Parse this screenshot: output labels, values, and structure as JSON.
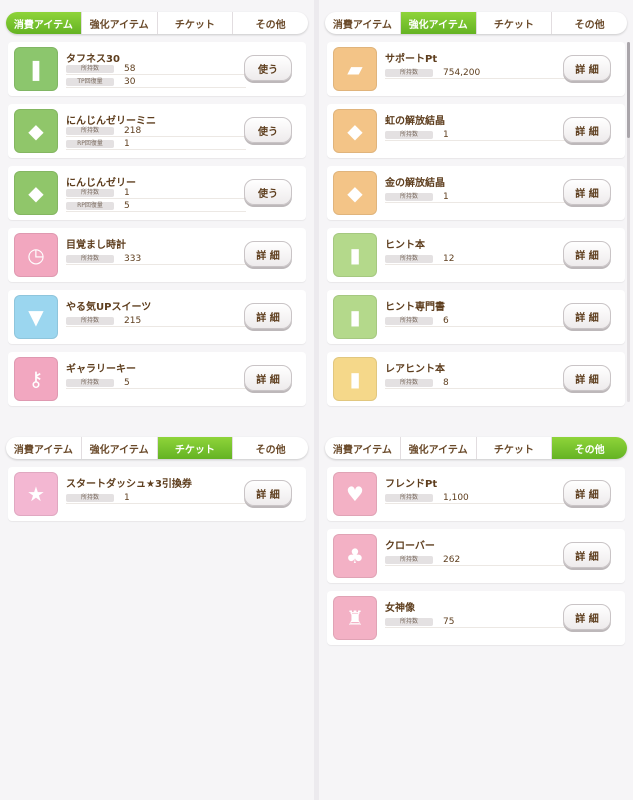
{
  "panels": [
    {
      "tabs": [
        {
          "label": "消費アイテム",
          "active": true
        },
        {
          "label": "強化アイテム",
          "active": false
        },
        {
          "label": "チケット",
          "active": false
        },
        {
          "label": "その他",
          "active": false
        }
      ],
      "items": [
        {
          "name": "タフネス30",
          "icon": "juice-bottle-icon",
          "icon_color": "#8cc66d",
          "stats": [
            {
              "label": "所持数",
              "value": "58"
            },
            {
              "label": "TP回復量",
              "value": "30"
            }
          ],
          "button": "使う"
        },
        {
          "name": "にんじんゼリーミニ",
          "icon": "carrot-jelly-mini-icon",
          "icon_color": "#90c66a",
          "stats": [
            {
              "label": "所持数",
              "value": "218"
            },
            {
              "label": "RP回復量",
              "value": "1"
            }
          ],
          "button": "使う"
        },
        {
          "name": "にんじんゼリー",
          "icon": "carrot-jelly-icon",
          "icon_color": "#90c66a",
          "stats": [
            {
              "label": "所持数",
              "value": "1"
            },
            {
              "label": "RP回復量",
              "value": "5"
            }
          ],
          "button": "使う"
        },
        {
          "name": "目覚まし時計",
          "icon": "alarm-clock-icon",
          "icon_color": "#f2a7bf",
          "stats": [
            {
              "label": "所持数",
              "value": "333"
            }
          ],
          "button": "詳 細"
        },
        {
          "name": "やる気UPスイーツ",
          "icon": "parfait-icon",
          "icon_color": "#9bd6ef",
          "stats": [
            {
              "label": "所持数",
              "value": "215"
            }
          ],
          "button": "詳 細"
        },
        {
          "name": "ギャラリーキー",
          "icon": "key-icon",
          "icon_color": "#f2a7c0",
          "stats": [
            {
              "label": "所持数",
              "value": "5"
            }
          ],
          "button": "詳 細"
        }
      ]
    },
    {
      "tabs": [
        {
          "label": "消費アイテム",
          "active": false
        },
        {
          "label": "強化アイテム",
          "active": true
        },
        {
          "label": "チケット",
          "active": false
        },
        {
          "label": "その他",
          "active": false
        }
      ],
      "items": [
        {
          "name": "サポートPt",
          "icon": "support-pt-icon",
          "icon_color": "#f3c487",
          "stats": [
            {
              "label": "所持数",
              "value": "754,200"
            }
          ],
          "button": "詳 細"
        },
        {
          "name": "虹の解放結晶",
          "icon": "rainbow-crystal-icon",
          "icon_color": "#f3c487",
          "stats": [
            {
              "label": "所持数",
              "value": "1"
            }
          ],
          "button": "詳 細"
        },
        {
          "name": "金の解放結晶",
          "icon": "gold-crystal-icon",
          "icon_color": "#f3c487",
          "stats": [
            {
              "label": "所持数",
              "value": "1"
            }
          ],
          "button": "詳 細"
        },
        {
          "name": "ヒント本",
          "icon": "hint-book-icon",
          "icon_color": "#b4d98b",
          "stats": [
            {
              "label": "所持数",
              "value": "12"
            }
          ],
          "button": "詳 細"
        },
        {
          "name": "ヒント専門書",
          "icon": "hint-textbook-icon",
          "icon_color": "#b4d98b",
          "stats": [
            {
              "label": "所持数",
              "value": "6"
            }
          ],
          "button": "詳 細"
        },
        {
          "name": "レアヒント本",
          "icon": "rare-hint-book-icon",
          "icon_color": "#f5d88a",
          "stats": [
            {
              "label": "所持数",
              "value": "8"
            }
          ],
          "button": "詳 細"
        }
      ]
    },
    {
      "tabs": [
        {
          "label": "消費アイテム",
          "active": false
        },
        {
          "label": "強化アイテム",
          "active": false
        },
        {
          "label": "チケット",
          "active": true
        },
        {
          "label": "その他",
          "active": false
        }
      ],
      "items": [
        {
          "name": "スタートダッシュ★3引換券",
          "icon": "ticket-icon",
          "icon_color": "#f3b7d2",
          "stats": [
            {
              "label": "所持数",
              "value": "1"
            }
          ],
          "button": "詳 細"
        }
      ]
    },
    {
      "tabs": [
        {
          "label": "消費アイテム",
          "active": false
        },
        {
          "label": "強化アイテム",
          "active": false
        },
        {
          "label": "チケット",
          "active": false
        },
        {
          "label": "その他",
          "active": true
        }
      ],
      "items": [
        {
          "name": "フレンドPt",
          "icon": "friend-pt-icon",
          "icon_color": "#f3b1c5",
          "stats": [
            {
              "label": "所持数",
              "value": "1,100"
            }
          ],
          "button": "詳 細"
        },
        {
          "name": "クローバー",
          "icon": "clover-icon",
          "icon_color": "#f3b1c5",
          "stats": [
            {
              "label": "所持数",
              "value": "262"
            }
          ],
          "button": "詳 細"
        },
        {
          "name": "女神像",
          "icon": "goddess-statue-icon",
          "icon_color": "#f3b1c5",
          "stats": [
            {
              "label": "所持数",
              "value": "75"
            }
          ],
          "button": "詳 細"
        }
      ]
    }
  ]
}
